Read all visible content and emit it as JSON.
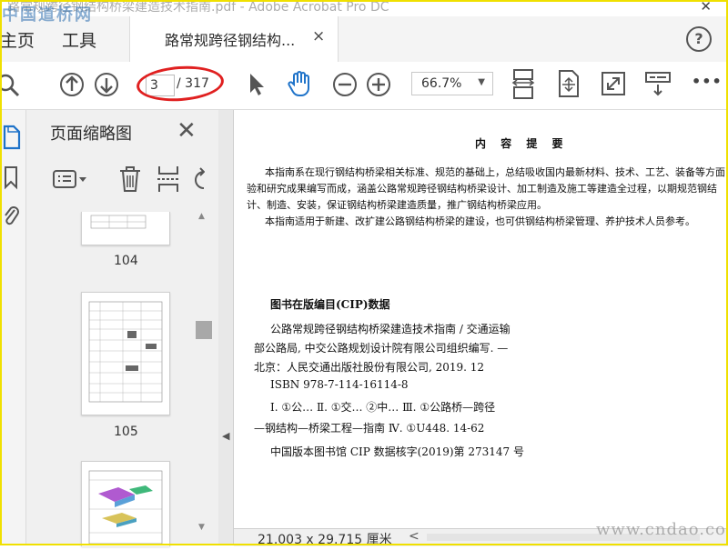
{
  "window": {
    "title": "路常规跨径钢结构桥梁建造技术指南.pdf - Adobe Acrobat Pro DC",
    "close_glyph": "✕"
  },
  "watermark": {
    "top": "中国道桥网",
    "bottom": "www.cndao.com"
  },
  "menubar": {
    "home": "主页",
    "tools": "工具",
    "doc_tab": "路常规跨径钢结构...",
    "doc_tab_close": "×",
    "help": "?"
  },
  "toolbar": {
    "current_page": "3",
    "total_pages": "/ 317",
    "zoom": "66.7%",
    "more": "•••"
  },
  "thumb_panel": {
    "title": "页面缩略图",
    "close": "✕",
    "pages": [
      "104",
      "105"
    ]
  },
  "document": {
    "heading": "内 容 提 要",
    "para1": [
      "本指南系在现行钢结构桥梁相关标准、规范的基础上，总结吸收国内最新材料、技术、工艺、装备等方面",
      "验和研究成果编写而成，涵盖公路常规跨径钢结构桥梁设计、加工制造及施工等建造全过程，以期规范钢结",
      "计、制造、安装，保证钢结构桥梁建造质量，推广钢结构桥梁应用。"
    ],
    "para2": "本指南适用于新建、改扩建公路钢结构桥梁的建设，也可供钢结构桥梁管理、养护技术人员参考。",
    "cip_title": "图书在版编目(CIP)数据",
    "cip_lines": [
      "公路常规跨径钢结构桥梁建造技术指南 / 交通运输",
      "部公路局, 中交公路规划设计院有限公司组织编写. —",
      "北京：人民交通出版社股份有限公司, 2019. 12",
      "ISBN 978-7-114-16114-8",
      "Ⅰ. ①公…   Ⅱ. ①交… ②中…   Ⅲ. ①公路桥—跨径",
      "—钢结构—桥梁工程—指南   Ⅳ. ①U448. 14-62",
      "中国版本图书馆 CIP 数据核字(2019)第 273147 号"
    ]
  },
  "statusbar": {
    "dimensions": "21.003 x 29.715 厘米",
    "scroll_left": "<"
  }
}
